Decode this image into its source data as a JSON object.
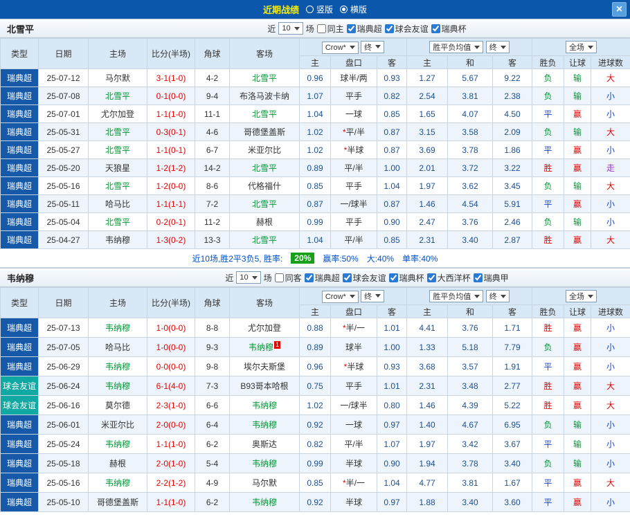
{
  "titlebar": {
    "title": "近期战绩",
    "vertical_label": "竖版",
    "horizontal_label": "横版",
    "close_label": "×"
  },
  "table_header": {
    "type": "类型",
    "date": "日期",
    "home": "主场",
    "score": "比分(半场)",
    "corner": "角球",
    "away": "客场",
    "company_dd": "Crow*",
    "final_dd": "终",
    "avg_dd": "胜平负均值",
    "final_dd2": "终",
    "scope_dd": "全场",
    "sub": {
      "home": "主",
      "handicap": "盘口",
      "away": "客",
      "home2": "主",
      "draw": "和",
      "away2": "客",
      "result": "胜负",
      "handicap_result": "让球",
      "goals": "进球数"
    }
  },
  "colors": {
    "titlebar_bg": "#0a57ac",
    "title_text": "#ffee00",
    "type_bg": {
      "瑞典超": "#1659a9",
      "球会友谊": "#0fa8a3"
    },
    "result": {
      "胜": "#e60000",
      "平": "#1b46c8",
      "负": "#009933"
    },
    "handicap_result": {
      "赢": "#e60000",
      "输": "#009933",
      "走": "#9933cc"
    },
    "goals": {
      "大": "#e60000",
      "小": "#1b46c8",
      "走": "#9933cc"
    },
    "focus_team": "#009933",
    "score": "#e60000",
    "odds": "#1d4f91",
    "win_rate_badge_bg": "#18a018"
  },
  "sections": [
    {
      "team": "北雪平",
      "filters": {
        "near": "近",
        "count": "10",
        "games": "场",
        "same": {
          "label": "同主",
          "checked": false
        },
        "leagues": [
          {
            "label": "瑞典超",
            "checked": true
          },
          {
            "label": "球会友谊",
            "checked": true
          },
          {
            "label": "瑞典杯",
            "checked": true
          }
        ]
      },
      "rows": [
        {
          "type": "瑞典超",
          "date": "25-07-12",
          "home": "马尔默",
          "score": "3-1(1-0)",
          "corner": "4-2",
          "away": "北雪平",
          "away_focus": true,
          "odds_home": "0.96",
          "handicap": "球半/两",
          "odds_away": "0.93",
          "avg_home": "1.27",
          "avg_draw": "5.67",
          "avg_away": "9.22",
          "result": "负",
          "let_result": "输",
          "goals": "大"
        },
        {
          "type": "瑞典超",
          "date": "25-07-08",
          "home": "北雪平",
          "home_focus": true,
          "score": "0-1(0-0)",
          "corner": "9-4",
          "away": "布洛马波卡纳",
          "odds_home": "1.07",
          "handicap": "平手",
          "odds_away": "0.82",
          "avg_home": "2.54",
          "avg_draw": "3.81",
          "avg_away": "2.38",
          "result": "负",
          "let_result": "输",
          "goals": "小"
        },
        {
          "type": "瑞典超",
          "date": "25-07-01",
          "home": "尤尔加登",
          "score": "1-1(1-0)",
          "corner": "11-1",
          "away": "北雪平",
          "away_focus": true,
          "odds_home": "1.04",
          "handicap": "一球",
          "odds_away": "0.85",
          "avg_home": "1.65",
          "avg_draw": "4.07",
          "avg_away": "4.50",
          "result": "平",
          "let_result": "赢",
          "goals": "小"
        },
        {
          "type": "瑞典超",
          "date": "25-05-31",
          "home": "北雪平",
          "home_focus": true,
          "score": "0-3(0-1)",
          "corner": "4-6",
          "away": "哥德堡盖斯",
          "odds_home": "1.02",
          "handicap": "*平/半",
          "odds_away": "0.87",
          "avg_home": "3.15",
          "avg_draw": "3.58",
          "avg_away": "2.09",
          "result": "负",
          "let_result": "输",
          "goals": "大"
        },
        {
          "type": "瑞典超",
          "date": "25-05-27",
          "home": "北雪平",
          "home_focus": true,
          "score": "1-1(0-1)",
          "corner": "6-7",
          "away": "米亚尔比",
          "odds_home": "1.02",
          "handicap": "*半球",
          "odds_away": "0.87",
          "avg_home": "3.69",
          "avg_draw": "3.78",
          "avg_away": "1.86",
          "result": "平",
          "let_result": "赢",
          "goals": "小"
        },
        {
          "type": "瑞典超",
          "date": "25-05-20",
          "home": "天狼星",
          "score": "1-2(1-2)",
          "corner": "14-2",
          "away": "北雪平",
          "away_focus": true,
          "odds_home": "0.89",
          "handicap": "平/半",
          "odds_away": "1.00",
          "avg_home": "2.01",
          "avg_draw": "3.72",
          "avg_away": "3.22",
          "result": "胜",
          "let_result": "赢",
          "goals": "走"
        },
        {
          "type": "瑞典超",
          "date": "25-05-16",
          "home": "北雪平",
          "home_focus": true,
          "score": "1-2(0-0)",
          "corner": "8-6",
          "away": "代格福什",
          "odds_home": "0.85",
          "handicap": "平手",
          "odds_away": "1.04",
          "avg_home": "1.97",
          "avg_draw": "3.62",
          "avg_away": "3.45",
          "result": "负",
          "let_result": "输",
          "goals": "大"
        },
        {
          "type": "瑞典超",
          "date": "25-05-11",
          "home": "哈马比",
          "score": "1-1(1-1)",
          "corner": "7-2",
          "away": "北雪平",
          "away_focus": true,
          "odds_home": "0.87",
          "handicap": "一/球半",
          "odds_away": "0.87",
          "avg_home": "1.46",
          "avg_draw": "4.54",
          "avg_away": "5.91",
          "result": "平",
          "let_result": "赢",
          "goals": "小"
        },
        {
          "type": "瑞典超",
          "date": "25-05-04",
          "home": "北雪平",
          "home_focus": true,
          "score": "0-2(0-1)",
          "corner": "11-2",
          "away": "赫根",
          "odds_home": "0.99",
          "handicap": "平手",
          "odds_away": "0.90",
          "avg_home": "2.47",
          "avg_draw": "3.76",
          "avg_away": "2.46",
          "result": "负",
          "let_result": "输",
          "goals": "小"
        },
        {
          "type": "瑞典超",
          "date": "25-04-27",
          "home": "韦纳穆",
          "score": "1-3(0-2)",
          "corner": "13-3",
          "away": "北雪平",
          "away_focus": true,
          "odds_home": "1.04",
          "handicap": "平/半",
          "odds_away": "0.85",
          "avg_home": "2.31",
          "avg_draw": "3.40",
          "avg_away": "2.87",
          "result": "胜",
          "let_result": "赢",
          "goals": "大"
        }
      ],
      "summary": {
        "record": "近10场,胜2平3负5, 胜率:",
        "win_rate": "20%",
        "asian_rate": "赢率:50%",
        "big_rate": "大:40%",
        "single_rate": "单率:40%"
      }
    },
    {
      "team": "韦纳穆",
      "filters": {
        "near": "近",
        "count": "10",
        "games": "场",
        "same": {
          "label": "同客",
          "checked": false
        },
        "leagues": [
          {
            "label": "瑞典超",
            "checked": true
          },
          {
            "label": "球会友谊",
            "checked": true
          },
          {
            "label": "瑞典杯",
            "checked": true
          },
          {
            "label": "大西洋杯",
            "checked": true
          },
          {
            "label": "瑞典甲",
            "checked": true
          }
        ]
      },
      "rows": [
        {
          "type": "瑞典超",
          "date": "25-07-13",
          "home": "韦纳穆",
          "home_focus": true,
          "score": "1-0(0-0)",
          "corner": "8-8",
          "away": "尤尔加登",
          "odds_home": "0.88",
          "handicap": "*半/一",
          "odds_away": "1.01",
          "avg_home": "4.41",
          "avg_draw": "3.76",
          "avg_away": "1.71",
          "result": "胜",
          "let_result": "赢",
          "goals": "小"
        },
        {
          "type": "瑞典超",
          "date": "25-07-05",
          "home": "哈马比",
          "score": "1-0(0-0)",
          "corner": "9-3",
          "away": "韦纳穆",
          "away_focus": true,
          "card": "1",
          "odds_home": "0.89",
          "handicap": "球半",
          "odds_away": "1.00",
          "avg_home": "1.33",
          "avg_draw": "5.18",
          "avg_away": "7.79",
          "result": "负",
          "let_result": "赢",
          "goals": "小"
        },
        {
          "type": "瑞典超",
          "date": "25-06-29",
          "home": "韦纳穆",
          "home_focus": true,
          "score": "0-0(0-0)",
          "corner": "9-8",
          "away": "埃尔夫斯堡",
          "odds_home": "0.96",
          "handicap": "*半球",
          "odds_away": "0.93",
          "avg_home": "3.68",
          "avg_draw": "3.57",
          "avg_away": "1.91",
          "result": "平",
          "let_result": "赢",
          "goals": "小"
        },
        {
          "type": "球会友谊",
          "date": "25-06-24",
          "home": "韦纳穆",
          "home_focus": true,
          "score": "6-1(4-0)",
          "corner": "7-3",
          "away": "B93哥本哈根",
          "odds_home": "0.75",
          "handicap": "平手",
          "odds_away": "1.01",
          "avg_home": "2.31",
          "avg_draw": "3.48",
          "avg_away": "2.77",
          "result": "胜",
          "let_result": "赢",
          "goals": "大"
        },
        {
          "type": "球会友谊",
          "date": "25-06-16",
          "home": "莫尔德",
          "score": "2-3(1-0)",
          "corner": "6-6",
          "away": "韦纳穆",
          "away_focus": true,
          "odds_home": "1.02",
          "handicap": "一/球半",
          "odds_away": "0.80",
          "avg_home": "1.46",
          "avg_draw": "4.39",
          "avg_away": "5.22",
          "result": "胜",
          "let_result": "赢",
          "goals": "大"
        },
        {
          "type": "瑞典超",
          "date": "25-06-01",
          "home": "米亚尔比",
          "score": "2-0(0-0)",
          "corner": "6-4",
          "away": "韦纳穆",
          "away_focus": true,
          "odds_home": "0.92",
          "handicap": "一球",
          "odds_away": "0.97",
          "avg_home": "1.40",
          "avg_draw": "4.67",
          "avg_away": "6.95",
          "result": "负",
          "let_result": "输",
          "goals": "小"
        },
        {
          "type": "瑞典超",
          "date": "25-05-24",
          "home": "韦纳穆",
          "home_focus": true,
          "score": "1-1(1-0)",
          "corner": "6-2",
          "away": "奥斯达",
          "odds_home": "0.82",
          "handicap": "平/半",
          "odds_away": "1.07",
          "avg_home": "1.97",
          "avg_draw": "3.42",
          "avg_away": "3.67",
          "result": "平",
          "let_result": "输",
          "goals": "小"
        },
        {
          "type": "瑞典超",
          "date": "25-05-18",
          "home": "赫根",
          "score": "2-0(1-0)",
          "corner": "5-4",
          "away": "韦纳穆",
          "away_focus": true,
          "odds_home": "0.99",
          "handicap": "半球",
          "odds_away": "0.90",
          "avg_home": "1.94",
          "avg_draw": "3.78",
          "avg_away": "3.40",
          "result": "负",
          "let_result": "输",
          "goals": "小"
        },
        {
          "type": "瑞典超",
          "date": "25-05-16",
          "home": "韦纳穆",
          "home_focus": true,
          "score": "2-2(1-2)",
          "corner": "4-9",
          "away": "马尔默",
          "odds_home": "0.85",
          "handicap": "*半/一",
          "odds_away": "1.04",
          "avg_home": "4.77",
          "avg_draw": "3.81",
          "avg_away": "1.67",
          "result": "平",
          "let_result": "赢",
          "goals": "大"
        },
        {
          "type": "瑞典超",
          "date": "25-05-10",
          "home": "哥德堡盖斯",
          "score": "1-1(1-0)",
          "corner": "6-2",
          "away": "韦纳穆",
          "away_focus": true,
          "odds_home": "0.92",
          "handicap": "半球",
          "odds_away": "0.97",
          "avg_home": "1.88",
          "avg_draw": "3.40",
          "avg_away": "3.60",
          "result": "平",
          "let_result": "赢",
          "goals": "小"
        }
      ]
    }
  ]
}
